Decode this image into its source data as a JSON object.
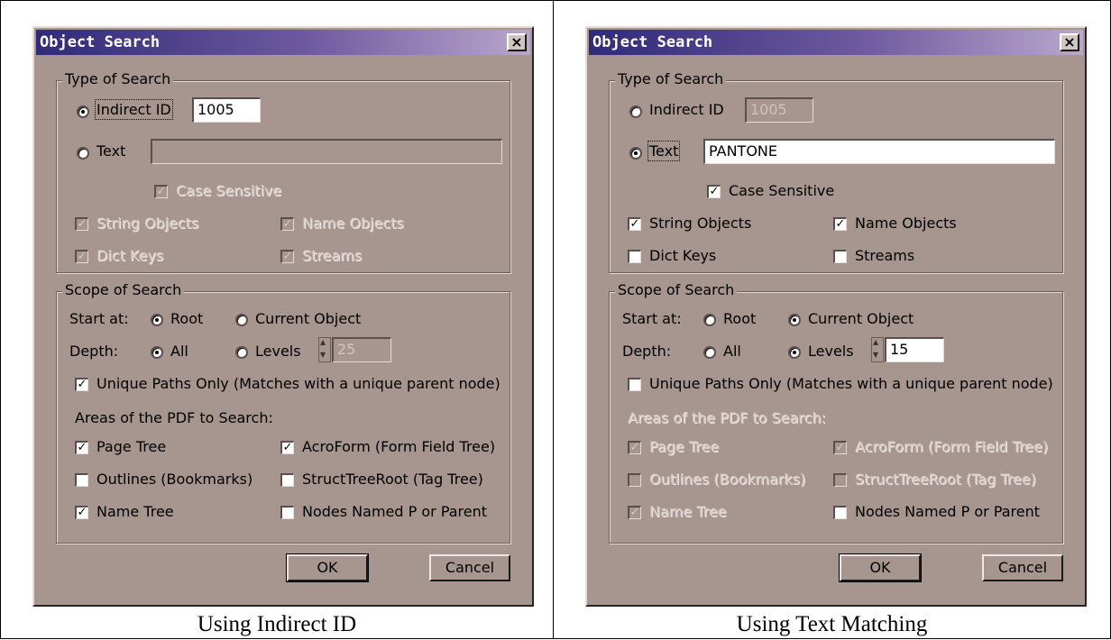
{
  "left": {
    "caption": "Using Indirect ID",
    "dialog": {
      "title": "Object Search",
      "close": "×",
      "type_group": "Type of Search",
      "indirect_label": "Indirect ID",
      "indirect_value": "1005",
      "text_label": "Text",
      "text_value": "",
      "case_label": "Case Sensitive",
      "string_label": "String Objects",
      "name_label": "Name Objects",
      "dict_label": "Dict Keys",
      "streams_label": "Streams",
      "scope_group": "Scope of Search",
      "start_label": "Start at:",
      "root_label": "Root",
      "current_label": "Current Object",
      "depth_label": "Depth:",
      "all_label": "All",
      "levels_label": "Levels",
      "levels_value": "25",
      "unique_label": "Unique Paths Only (Matches with a unique parent node)",
      "areas_label": "Areas of the PDF to Search:",
      "pagetree_label": "Page Tree",
      "acroform_label": "AcroForm (Form Field Tree)",
      "outlines_label": "Outlines (Bookmarks)",
      "struct_label": "StructTreeRoot (Tag Tree)",
      "nametree_label": "Name Tree",
      "nodes_label": "Nodes Named P or Parent",
      "ok_label": "OK",
      "cancel_label": "Cancel",
      "checkmark": "✓"
    }
  },
  "right": {
    "caption": "Using Text Matching",
    "dialog": {
      "title": "Object Search",
      "close": "×",
      "type_group": "Type of Search",
      "indirect_label": "Indirect ID",
      "indirect_value": "1005",
      "text_label": "Text",
      "text_value": "PANTONE",
      "case_label": "Case Sensitive",
      "string_label": "String Objects",
      "name_label": "Name Objects",
      "dict_label": "Dict Keys",
      "streams_label": "Streams",
      "scope_group": "Scope of Search",
      "start_label": "Start at:",
      "root_label": "Root",
      "current_label": "Current Object",
      "depth_label": "Depth:",
      "all_label": "All",
      "levels_label": "Levels",
      "levels_value": "15",
      "unique_label": "Unique Paths Only (Matches with a unique parent node)",
      "areas_label": "Areas of the PDF to Search:",
      "pagetree_label": "Page Tree",
      "acroform_label": "AcroForm (Form Field Tree)",
      "outlines_label": "Outlines (Bookmarks)",
      "struct_label": "StructTreeRoot (Tag Tree)",
      "nametree_label": "Name Tree",
      "nodes_label": "Nodes Named P or Parent",
      "ok_label": "OK",
      "cancel_label": "Cancel",
      "checkmark": "✓"
    }
  }
}
